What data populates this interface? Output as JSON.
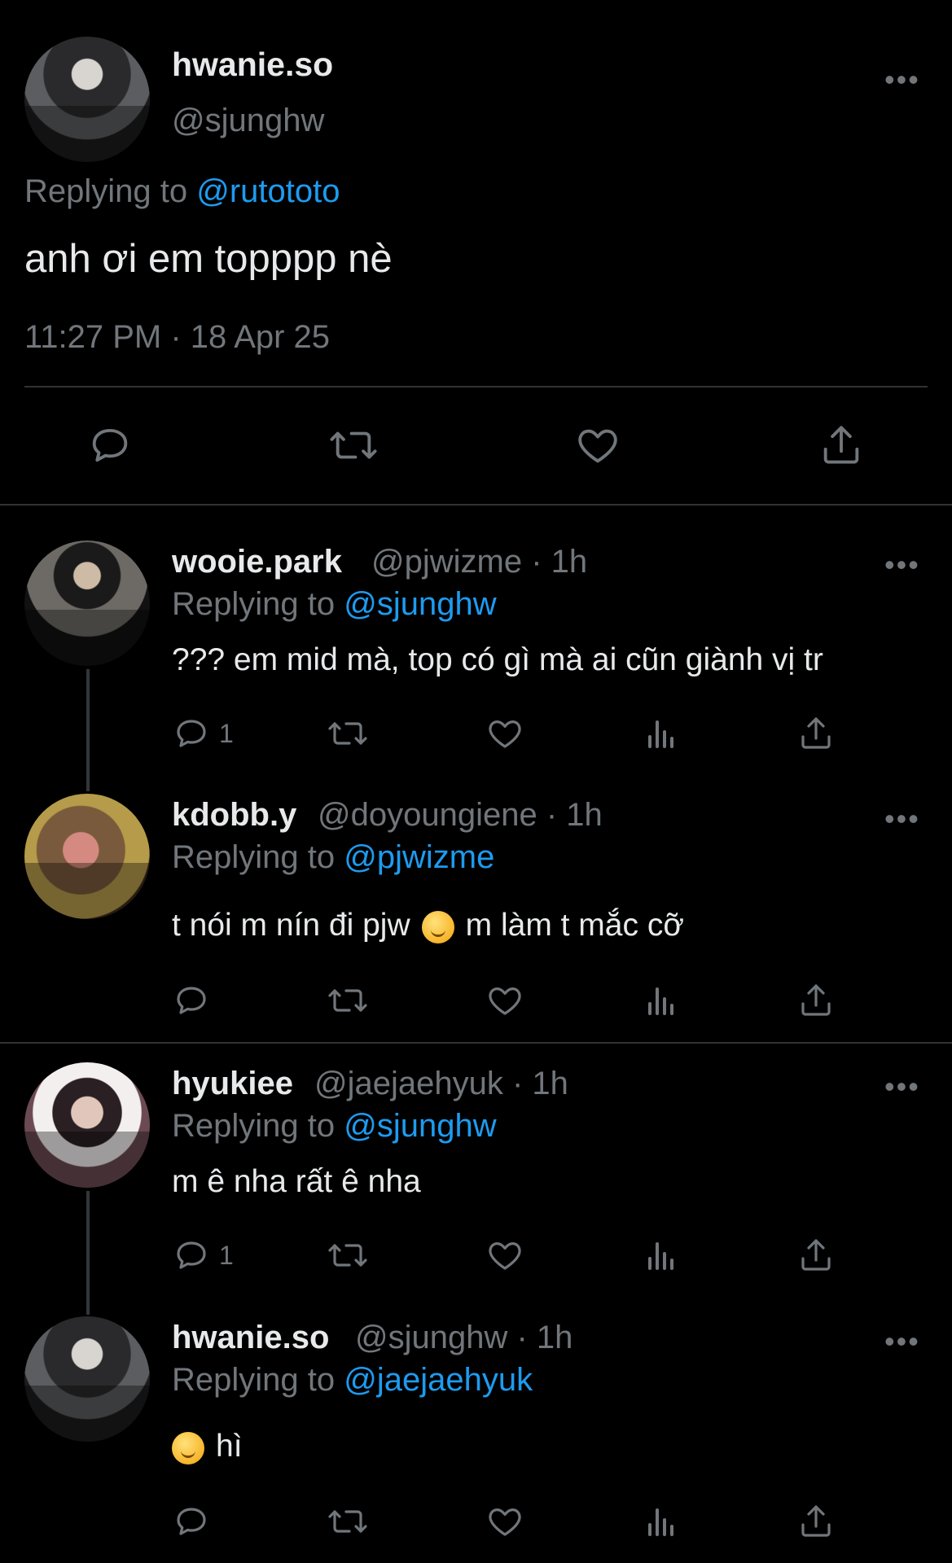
{
  "main_tweet": {
    "display_name": "hwanie.so",
    "handle": "@sjunghw",
    "replying_prefix": "Replying to",
    "replying_to": "@rutototo",
    "text": "anh ơi em topppp nè",
    "timestamp": "11:27 PM · 18 Apr 25",
    "more": "•••"
  },
  "replies": [
    {
      "display_name": "wooie.park",
      "handle_time": "@pjwizme · 1h",
      "replying_prefix": "Replying to",
      "replying_to": "@sjunghw",
      "text": "??? em mid mà, top có gì mà ai cũn giành vị tr",
      "reply_count": "1",
      "more": "•••"
    },
    {
      "display_name": "kdobb.y",
      "handle_time": "@doyoungiene · 1h",
      "replying_prefix": "Replying to",
      "replying_to": "@pjwizme",
      "text_before": "t nói m nín đi pjw",
      "text_after": "m làm t mắc cỡ",
      "emoji": "upside-down-face-emoji",
      "reply_count": "",
      "more": "•••"
    },
    {
      "display_name": "hyukiee",
      "handle_time": "@jaejaehyuk · 1h",
      "replying_prefix": "Replying to",
      "replying_to": "@sjunghw",
      "text": "m ê nha rất ê nha",
      "reply_count": "1",
      "more": "•••"
    },
    {
      "display_name": "hwanie.so",
      "handle_time": "@sjunghw · 1h",
      "replying_prefix": "Replying to",
      "replying_to": "@jaejaehyuk",
      "text_after": "hì",
      "emoji": "yum-face-emoji",
      "reply_count": "",
      "more": "•••"
    }
  ],
  "icons": {
    "reply": "reply-icon",
    "retweet": "retweet-icon",
    "like": "like-icon",
    "views": "views-icon",
    "share": "share-icon"
  },
  "colors": {
    "background": "#000000",
    "text": "#e7e9ea",
    "secondary": "#71767b",
    "link": "#1d9bf0",
    "divider": "#2f3336"
  }
}
